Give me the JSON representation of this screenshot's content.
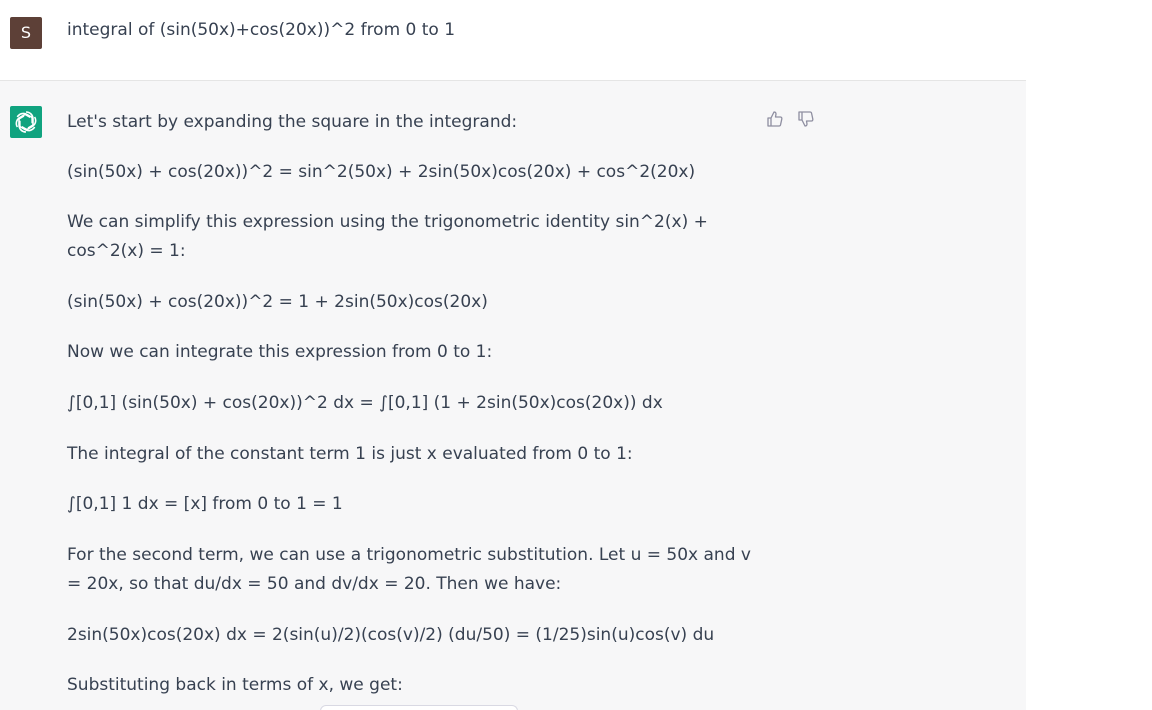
{
  "user": {
    "avatar_letter": "S",
    "message": "integral of (sin(50x)+cos(20x))^2 from 0 to 1"
  },
  "assistant": {
    "paragraphs": [
      "Let's start by expanding the square in the integrand:",
      "(sin(50x) + cos(20x))^2 = sin^2(50x) + 2sin(50x)cos(20x) + cos^2(20x)",
      "We can simplify this expression using the trigonometric identity sin^2(x) + cos^2(x) = 1:",
      "(sin(50x) + cos(20x))^2 = 1 + 2sin(50x)cos(20x)",
      "Now we can integrate this expression from 0 to 1:",
      "∫[0,1] (sin(50x) + cos(20x))^2 dx = ∫[0,1] (1 + 2sin(50x)cos(20x)) dx",
      "The integral of the constant term 1 is just x evaluated from 0 to 1:",
      "∫[0,1] 1 dx = [x] from 0 to 1 = 1",
      "For the second term, we can use a trigonometric substitution. Let u = 50x and v = 20x, so that du/dx = 50 and dv/dx = 20. Then we have:",
      "2sin(50x)cos(20x) dx = 2(sin(u)/2)(cos(v)/2) (du/50) = (1/25)sin(u)cos(v) du",
      "Substituting back in terms of x, we get:"
    ]
  },
  "colors": {
    "user_avatar": "#5d4037",
    "assistant_avatar": "#10a37f",
    "assistant_background": "#f7f7f8"
  }
}
